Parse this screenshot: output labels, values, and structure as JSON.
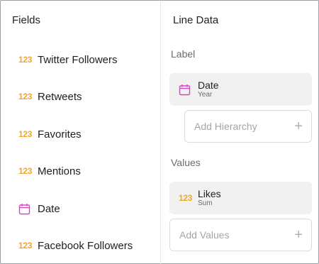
{
  "fields_panel": {
    "title": "Fields",
    "items": [
      {
        "type": "123",
        "label": "Twitter Followers"
      },
      {
        "type": "123",
        "label": "Retweets"
      },
      {
        "type": "123",
        "label": "Favorites"
      },
      {
        "type": "123",
        "label": "Mentions"
      },
      {
        "type": "calendar",
        "label": "Date"
      },
      {
        "type": "123",
        "label": "Facebook Followers"
      }
    ]
  },
  "line_data": {
    "title": "Line Data",
    "label_section": {
      "heading": "Label",
      "chip": {
        "name": "Date",
        "sub": "Year",
        "icon": "calendar-icon"
      },
      "add_placeholder": "Add Hierarchy"
    },
    "values_section": {
      "heading": "Values",
      "chip": {
        "name": "Likes",
        "sub": "Sum",
        "icon_text": "123"
      },
      "add_placeholder": "Add Values"
    }
  },
  "colors": {
    "number_icon": "#f5a623",
    "date_icon": "#e040c8"
  }
}
